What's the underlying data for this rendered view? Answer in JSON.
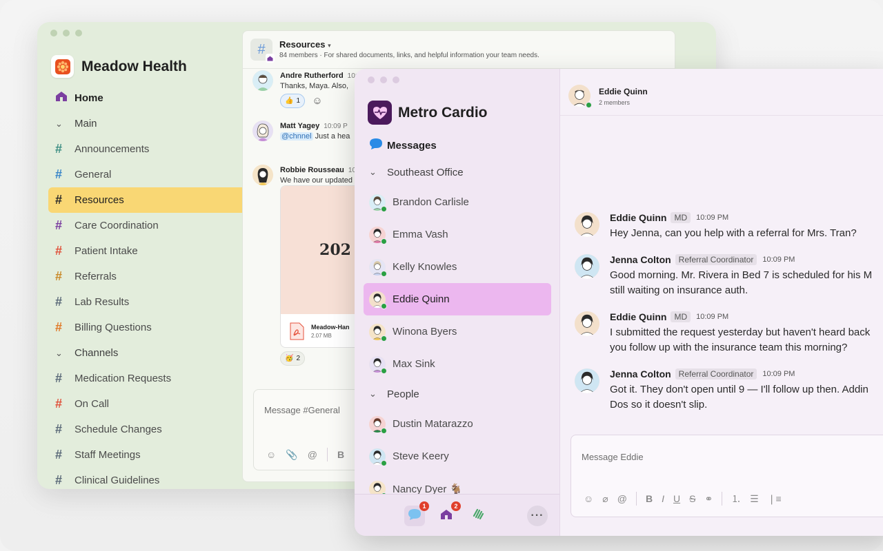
{
  "meadow": {
    "title": "Meadow Health",
    "nav": {
      "home": "Home",
      "main_section": "Main",
      "main_channels": [
        "Announcements",
        "General",
        "Resources",
        "Care Coordination",
        "Patient Intake",
        "Referrals",
        "Lab Results",
        "Billing Questions"
      ],
      "channels_section": "Channels",
      "channels": [
        "Medication Requests",
        "On Call",
        "Schedule Changes",
        "Staff Meetings",
        "Clinical Guidelines"
      ]
    },
    "hash_colors": [
      "#3f8f84",
      "#3a86c8",
      "#2b2b2b",
      "#7b3fa0",
      "#e0533d",
      "#c98a2a",
      "#5c6b7a",
      "#e07a2a",
      "#5c6b7a",
      "#e0533d",
      "#5c6b7a",
      "#5c6b7a",
      "#5c6b7a"
    ],
    "channel_header": {
      "name": "Resources",
      "description": "84 members · For shared documents, links, and helpful information your team needs."
    },
    "messages": [
      {
        "author": "Andre Rutherford",
        "time": "10:0",
        "text": "Thanks, Maya. Also,"
      },
      {
        "author": "Matt Yagey",
        "time": "10:09 P",
        "mention": "@chnnel",
        "text": "Just a hea"
      },
      {
        "author": "Robbie Rousseau",
        "time": "10:0",
        "text": "We have our updated"
      }
    ],
    "reactions": {
      "thumbs": "1",
      "party": "2"
    },
    "attachment": {
      "preview": "202",
      "name": "Meadow-Han",
      "size": "2.07 MB"
    },
    "composer_placeholder": "Message #General"
  },
  "metro": {
    "title": "Metro Cardio",
    "messages_label": "Messages",
    "southeast_section": "Southeast Office",
    "southeast_dms": [
      "Brandon Carlisle",
      "Emma Vash",
      "Kelly  Knowles",
      "Eddie Quinn",
      "Winona Byers",
      "Max Sink"
    ],
    "people_section": "People",
    "people_dms": [
      "Dustin Matarazzo",
      "Steve Keery",
      "Nancy Dyer 🐐"
    ],
    "badges": {
      "messages": "1",
      "home": "2"
    },
    "dm_header": {
      "name": "Eddie Quinn",
      "members": "2 members"
    },
    "dm_messages": [
      {
        "author": "Eddie Quinn",
        "role": "MD",
        "time": "10:09 PM",
        "lines": [
          "Hey Jenna, can you help with a referral for Mrs. Tran?"
        ]
      },
      {
        "author": "Jenna Colton",
        "role": "Referral Coordinator",
        "time": "10:09 PM",
        "lines": [
          "Good morning. Mr. Rivera in Bed 7 is scheduled for his M",
          "still waiting on insurance auth."
        ]
      },
      {
        "author": "Eddie Quinn",
        "role": "MD",
        "time": "10:09 PM",
        "lines": [
          "I submitted the request yesterday but haven't heard back",
          "you follow up with the insurance team this morning?"
        ]
      },
      {
        "author": "Jenna Colton",
        "role": "Referral Coordinator",
        "time": "10:09 PM",
        "lines": [
          "Got it. They don't open until 9 — I'll follow up then. Addin",
          "Dos so it doesn't slip."
        ]
      }
    ],
    "composer_placeholder": "Message Eddie"
  },
  "colors": {
    "active_channel": "#f9d774",
    "active_dm": "#ecb7ef",
    "brand_purple": "#4b1a5c",
    "online": "#2aa043",
    "badge": "#e0402d"
  }
}
